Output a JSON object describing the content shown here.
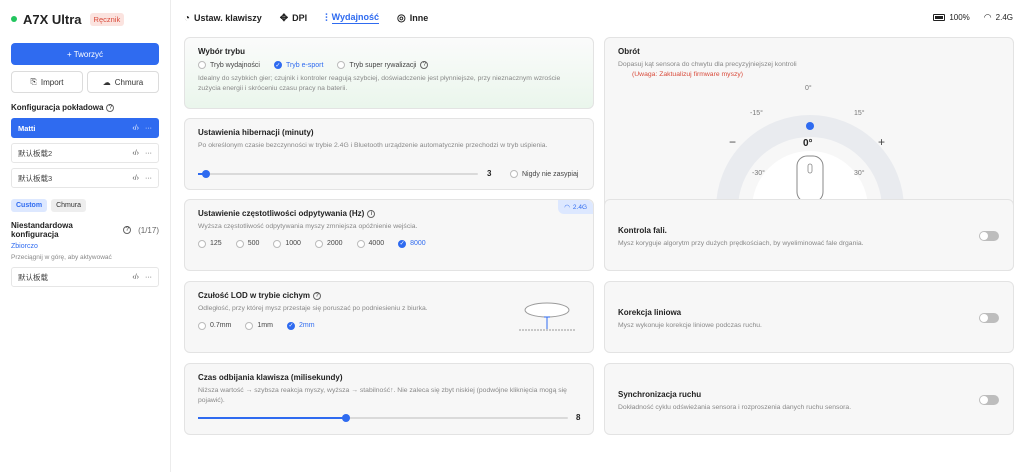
{
  "sidebar": {
    "device_name": "A7X Ultra",
    "badge": "Ręcznik",
    "create_label": "+ Tworzyć",
    "import_label": "Import",
    "cloud_label": "Chmura",
    "onboard_title": "Konfiguracja pokładowa",
    "onboard_items": [
      {
        "label": "Matti",
        "active": true
      },
      {
        "label": "默认板载2",
        "active": false
      },
      {
        "label": "默认板载3",
        "active": false
      }
    ],
    "seg_custom": "Custom",
    "seg_cloud": "Chmura",
    "custom_title": "Niestandardowa konfiguracja",
    "custom_count": "(1/17)",
    "collapse_link": "Zbiorczo",
    "drag_hint": "Przeciągnij w górę, aby aktywować",
    "custom_items": [
      {
        "label": "默认板载"
      }
    ]
  },
  "nav": {
    "tabs": [
      {
        "label": "Ustaw. klawiszy",
        "active": false
      },
      {
        "label": "DPI",
        "active": false
      },
      {
        "label": "Wydajność",
        "active": true
      },
      {
        "label": "Inne",
        "active": false
      }
    ],
    "battery": "100%",
    "signal": "2.4G"
  },
  "mode": {
    "title": "Wybór trybu",
    "options": [
      "Tryb wydajności",
      "Tryb e-sport",
      "Tryb super rywalizacji"
    ],
    "selected": 1,
    "desc": "Idealny do szybkich gier; czujnik i kontroler reagują szybciej, doświadczenie jest płynniejsze, przy nieznacznym wzroście zużycia energii i skróceniu czasu pracy na baterii."
  },
  "hibernate": {
    "title": "Ustawienia hibernacji (minuty)",
    "desc": "Po określonym czasie bezczynności w trybie 2.4G i Bluetooth urządzenie automatycznie przechodzi w tryb uśpienia.",
    "value": "3",
    "fraction": 0.03,
    "never_label": "Nigdy nie zasypiaj"
  },
  "polling": {
    "title": "Ustawienie częstotliwości odpytywania (Hz)",
    "desc": "Wyższa częstotliwość odpytywania myszy zmniejsza opóźnienie wejścia.",
    "badge": "2.4G",
    "options": [
      "125",
      "500",
      "1000",
      "2000",
      "4000",
      "8000"
    ],
    "selected": 5
  },
  "lod": {
    "title": "Czułość LOD w trybie cichym",
    "desc": "Odległość, przy której mysz przestaje się poruszać po podniesieniu z biurka.",
    "options": [
      "0.7mm",
      "1mm",
      "2mm"
    ],
    "selected": 2
  },
  "debounce": {
    "title": "Czas odbijania klawisza (milisekundy)",
    "desc": "Niższa wartość → szybsza reakcja myszy, wyższa → stabilność↑. Nie zaleca się zbyt niskiej (podwójne kliknięcia mogą się pojawić).",
    "value": "8",
    "fraction": 0.4
  },
  "rotation": {
    "title": "Obrót",
    "desc": "Dopasuj kąt sensora do chwytu dla precyzyjniejszej kontroli",
    "warning": "(Uwaga: Zaktualizuj firmware myszy)",
    "value": "0°",
    "ticks": [
      "0°",
      "-15°",
      "15°",
      "-30°",
      "30°"
    ],
    "minus": "−",
    "plus": "+"
  },
  "ripple": {
    "title": "Kontrola fali.",
    "desc": "Mysz koryguje algorytm przy dużych prędkościach, by wyeliminować fale drgania.",
    "enabled": false
  },
  "linear": {
    "title": "Korekcja liniowa",
    "desc": "Mysz wykonuje korekcje liniowe podczas ruchu.",
    "enabled": false
  },
  "motion_sync": {
    "title": "Synchronizacja ruchu",
    "desc": "Dokładność cyklu odświeżania sensora i rozproszenia danych ruchu sensora.",
    "enabled": false
  },
  "colors": {
    "accent": "#2f6bf0",
    "warning": "#d94b3b"
  }
}
